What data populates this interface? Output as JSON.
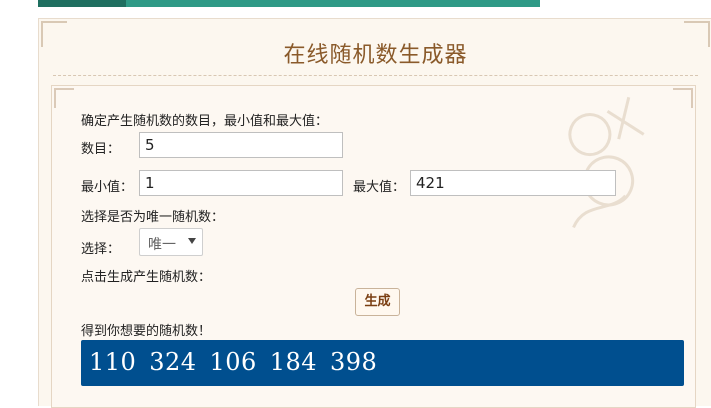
{
  "page": {
    "title": "在线随机数生成器"
  },
  "form": {
    "instruction": "确定产生随机数的数目，最小值和最大值：",
    "count_label": "数目：",
    "count_value": "5",
    "min_label": "最小值：",
    "min_value": "1",
    "max_label": "最大值：",
    "max_value": "421",
    "unique_prompt": "选择是否为唯一随机数：",
    "unique_label": "选择：",
    "unique_selected": "唯一",
    "generate_prompt": "点击生成产生随机数：",
    "generate_button": "生成",
    "result_label": "得到你想要的随机数！",
    "result_numbers": "110  324  106  184  398"
  },
  "colors": {
    "result_bg": "#004f8f",
    "accent_green": "#2f9a86",
    "title_brown": "#8a5a2a"
  }
}
